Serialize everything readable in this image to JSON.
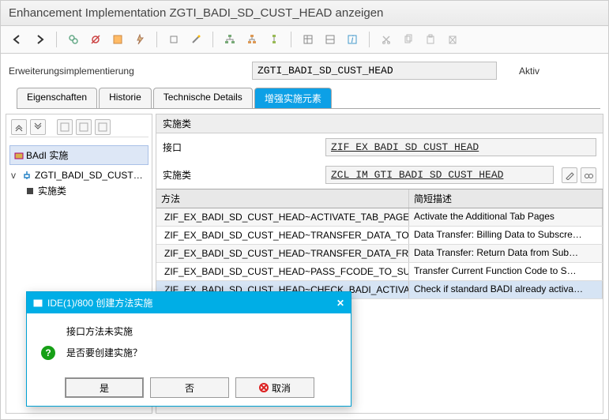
{
  "title": "Enhancement Implementation ZGTI_BADI_SD_CUST_HEAD anzeigen",
  "form": {
    "label": "Erweiterungsimplementierung",
    "value": "ZGTI_BADI_SD_CUST_HEAD",
    "status": "Aktiv"
  },
  "tabs": [
    "Eigenschaften",
    "Historie",
    "Technische Details",
    "增强实施元素"
  ],
  "active_tab": 3,
  "sidebar": {
    "header": "BAdI 实施",
    "root": "ZGTI_BADI_SD_CUST…",
    "child": "实施类"
  },
  "main": {
    "group": "实施类",
    "fields": {
      "interface_label": "接口",
      "interface_value": "ZIF_EX_BADI_SD_CUST_HEAD",
      "class_label": "实施类",
      "class_value": "ZCL_IM_GTI_BADI_SD_CUST_HEAD"
    },
    "columns": {
      "method": "方法",
      "desc": "简短描述"
    },
    "rows": [
      {
        "method": "ZIF_EX_BADI_SD_CUST_HEAD~ACTIVATE_TAB_PAGE",
        "desc": "Activate the Additional Tab Pages"
      },
      {
        "method": "ZIF_EX_BADI_SD_CUST_HEAD~TRANSFER_DATA_TO_S…",
        "desc": "Data Transfer: Billing Data to Subscre…"
      },
      {
        "method": "ZIF_EX_BADI_SD_CUST_HEAD~TRANSFER_DATA_FROM…",
        "desc": "Data Transfer: Return Data from Sub…"
      },
      {
        "method": "ZIF_EX_BADI_SD_CUST_HEAD~PASS_FCODE_TO_SUBS…",
        "desc": "Transfer Current Function Code to S…"
      },
      {
        "method": "ZIF_EX_BADI_SD_CUST_HEAD~CHECK_BADI_ACTIVATE",
        "desc": "Check if standard BADI already activa…",
        "hl": true
      }
    ]
  },
  "dialog": {
    "title": "IDE(1)/800 创建方法实施",
    "line1": "接口方法未实施",
    "line2": "是否要创建实施？",
    "yes": "是",
    "no": "否",
    "cancel": "取消"
  }
}
